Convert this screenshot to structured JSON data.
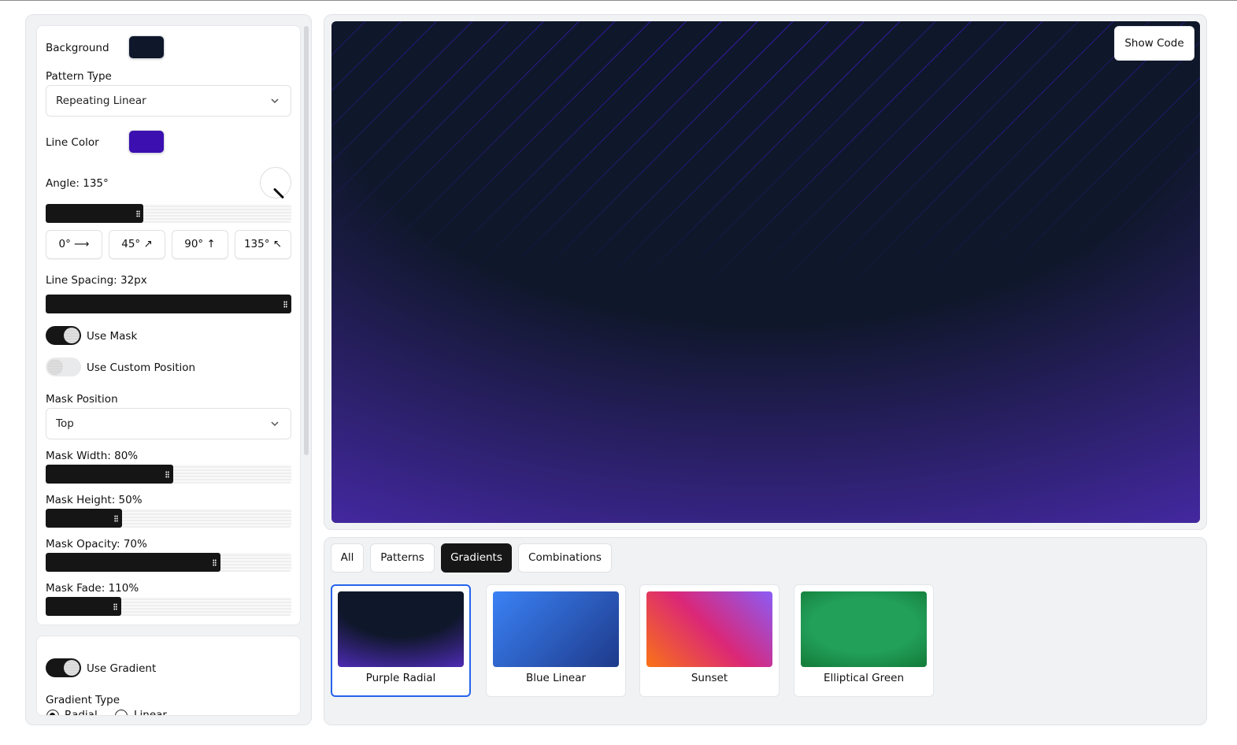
{
  "controls": {
    "background": {
      "label": "Background",
      "color": "#0f172a"
    },
    "pattern_type": {
      "label": "Pattern Type",
      "value": "Repeating Linear"
    },
    "line_color": {
      "label": "Line Color",
      "color": "#3b0fb0"
    },
    "angle": {
      "label": "Angle: 135°",
      "value_deg": 135,
      "fraction": 0.375
    },
    "angle_presets": [
      "0° ⟶",
      "45° ↗",
      "90° ↑",
      "135° ↖"
    ],
    "line_spacing": {
      "label": "Line Spacing: 32px",
      "fraction": 1.0
    },
    "use_mask": {
      "label": "Use Mask",
      "on": true
    },
    "use_custom_position": {
      "label": "Use Custom Position",
      "on": false
    },
    "mask_position": {
      "label": "Mask Position",
      "value": "Top"
    },
    "mask_width": {
      "label": "Mask Width: 80%",
      "fraction": 0.52
    },
    "mask_height": {
      "label": "Mask Height: 50%",
      "fraction": 0.31
    },
    "mask_opacity": {
      "label": "Mask Opacity: 70%",
      "fraction": 0.71
    },
    "mask_fade": {
      "label": "Mask Fade: 110%",
      "fraction": 0.31
    },
    "use_gradient": {
      "label": "Use Gradient",
      "on": true
    },
    "gradient_type": {
      "label": "Gradient Type",
      "options": [
        "Radial",
        "Linear"
      ],
      "selected": "Radial"
    }
  },
  "preview": {
    "show_code_label": "Show Code"
  },
  "tabs": [
    {
      "label": "All",
      "active": false
    },
    {
      "label": "Patterns",
      "active": false
    },
    {
      "label": "Gradients",
      "active": true
    },
    {
      "label": "Combinations",
      "active": false
    }
  ],
  "presets": [
    {
      "name": "Purple Radial",
      "selected": true
    },
    {
      "name": "Blue Linear",
      "selected": false
    },
    {
      "name": "Sunset",
      "selected": false
    },
    {
      "name": "Elliptical Green",
      "selected": false
    }
  ]
}
